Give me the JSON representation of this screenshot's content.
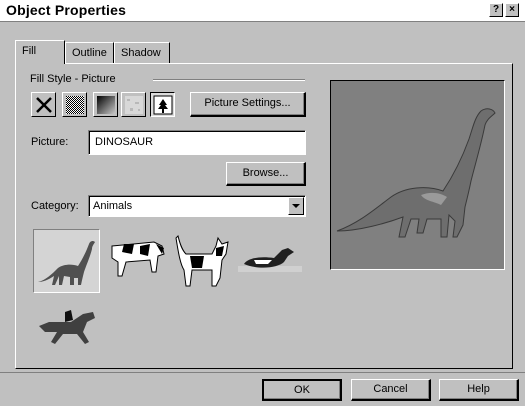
{
  "window": {
    "title": "Object Properties",
    "help_btn": "?",
    "close_btn": "×"
  },
  "tabs": [
    {
      "label": "Fill",
      "active": true
    },
    {
      "label": "Outline",
      "active": false
    },
    {
      "label": "Shadow",
      "active": false
    }
  ],
  "fill": {
    "style_label": "Fill Style - Picture",
    "styles": [
      "none-icon",
      "pattern-icon",
      "gradient-icon",
      "texture-icon",
      "picture-icon"
    ],
    "selected_style": "picture-icon",
    "picture_settings_label": "Picture Settings...",
    "picture_label": "Picture:",
    "picture_value": "DINOSAUR",
    "browse_label": "Browse...",
    "category_label": "Category:",
    "category_value": "Animals",
    "thumbnails": [
      "dinosaur-icon",
      "cow-icon",
      "cat-icon",
      "duck-icon",
      "horse-rider-icon"
    ],
    "selected_thumbnail": "dinosaur-icon"
  },
  "footer": {
    "ok_label": "OK",
    "cancel_label": "Cancel",
    "help_label": "Help"
  }
}
